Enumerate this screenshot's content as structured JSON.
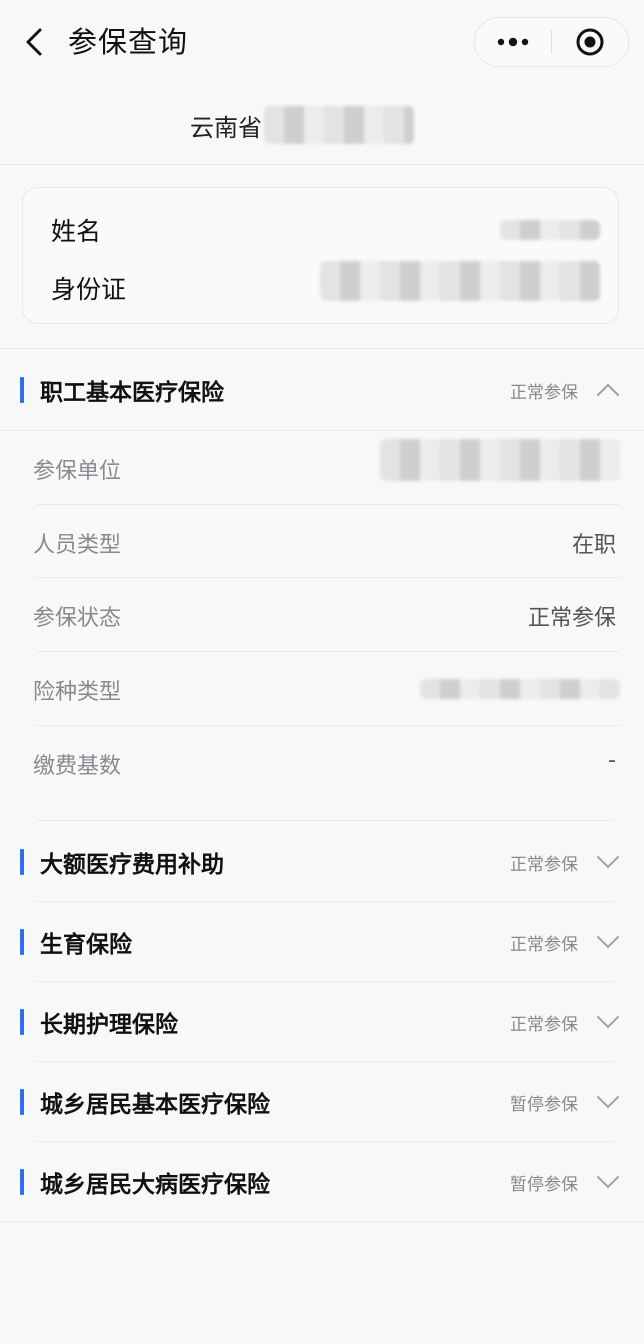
{
  "header": {
    "title": "参保查询"
  },
  "province": {
    "text": "云南省"
  },
  "person": {
    "name_label": "姓名",
    "id_label": "身份证"
  },
  "expanded_section": {
    "name": "职工基本医疗保险",
    "status": "正常参保",
    "rows": [
      {
        "label": "参保单位",
        "value": ""
      },
      {
        "label": "人员类型",
        "value": "在职"
      },
      {
        "label": "参保状态",
        "value": "正常参保"
      },
      {
        "label": "险种类型",
        "value": ""
      },
      {
        "label": "缴费基数",
        "value": "-"
      }
    ]
  },
  "sections": [
    {
      "name": "大额医疗费用补助",
      "status": "正常参保"
    },
    {
      "name": "生育保险",
      "status": "正常参保"
    },
    {
      "name": "长期护理保险",
      "status": "正常参保"
    },
    {
      "name": "城乡居民基本医疗保险",
      "status": "暂停参保"
    },
    {
      "name": "城乡居民大病医疗保险",
      "status": "暂停参保"
    }
  ],
  "colors": {
    "accent": "#2f6fed",
    "background": "#f8f8fa"
  },
  "icons": {
    "back": "chevron-left-icon",
    "more": "more-dots-icon",
    "target": "target-icon",
    "collapse": "chevron-up-icon",
    "expand": "chevron-down-icon"
  }
}
